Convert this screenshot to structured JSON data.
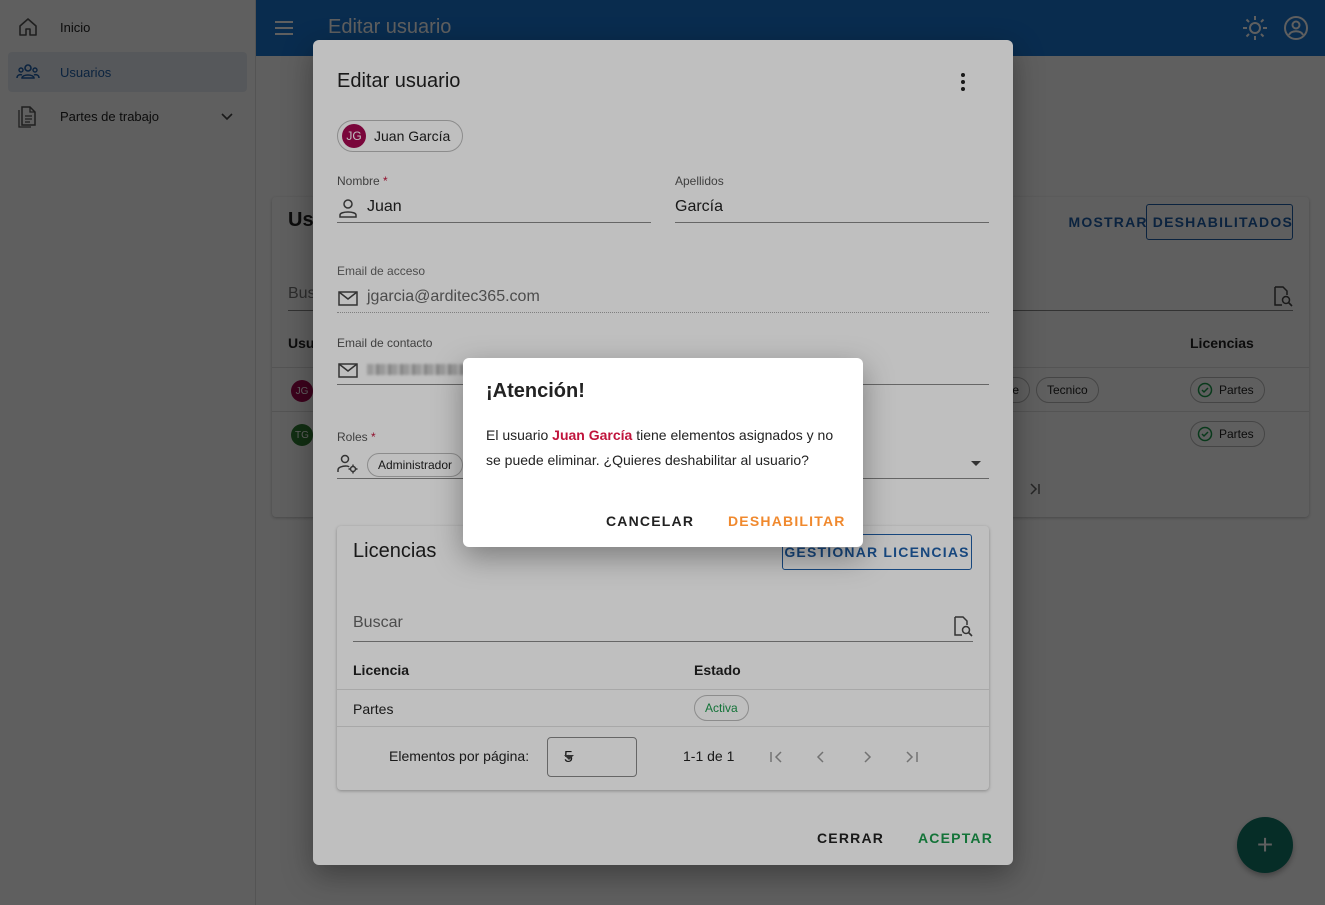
{
  "sidebar": {
    "items": [
      {
        "label": "Inicio",
        "icon": "home-icon"
      },
      {
        "label": "Usuarios",
        "icon": "users-icon",
        "active": true
      },
      {
        "label": "Partes de trabajo",
        "icon": "document-icon"
      }
    ]
  },
  "appbar": {
    "title": "Editar usuario",
    "icons": [
      "menu-icon",
      "brightness-icon",
      "account-icon"
    ]
  },
  "users_card": {
    "title": "Us",
    "show_disabled_label": "MOSTRAR DESHABILITADOS",
    "search_placeholder": "Bus",
    "headers": {
      "user": "Usu",
      "licenses": "Licencias"
    },
    "rows": [
      {
        "initials": "JG",
        "avatar_color": "#a3084f",
        "roles": [
          "ole",
          "Tecnico"
        ],
        "license": "Partes"
      },
      {
        "initials": "TG",
        "avatar_color": "#2e7d32",
        "roles": [],
        "license": "Partes"
      }
    ]
  },
  "dialog": {
    "title": "Editar usuario",
    "user_chip": {
      "initials": "JG",
      "name": "Juan García"
    },
    "fields": {
      "nombre": {
        "label": "Nombre",
        "required": "*",
        "value": "Juan"
      },
      "apellidos": {
        "label": "Apellidos",
        "value": "García"
      },
      "email_acceso": {
        "label": "Email de acceso",
        "value": "jgarcia@arditec365.com"
      },
      "email_contacto": {
        "label": "Email de contacto"
      },
      "roles": {
        "label": "Roles",
        "required": "*",
        "chip": "Administrador"
      }
    },
    "licencias": {
      "title": "Licencias",
      "manage_label": "GESTIONAR LICENCIAS",
      "search_placeholder": "Buscar",
      "columns": [
        "Licencia",
        "Estado"
      ],
      "rows": [
        {
          "licencia": "Partes",
          "estado": "Activa"
        }
      ],
      "pager": {
        "per_page_label": "Elementos por página:",
        "per_page": "5",
        "range": "1-1 de 1"
      }
    },
    "close_label": "CERRAR",
    "accept_label": "ACEPTAR"
  },
  "alert": {
    "title": "¡Atención!",
    "msg_pre": "El usuario ",
    "msg_name": "Juan García",
    "msg_post": " tiene elementos asignados y no se puede eliminar. ¿Quieres deshabilitar al usuario?",
    "cancel_label": "CANCELAR",
    "disable_label": "DESHABILITAR"
  },
  "colors": {
    "primary": "#1976d2",
    "accept": "#1a9a4b",
    "warning": "#f0892e",
    "danger": "#c0143c",
    "fab": "#13796b"
  }
}
